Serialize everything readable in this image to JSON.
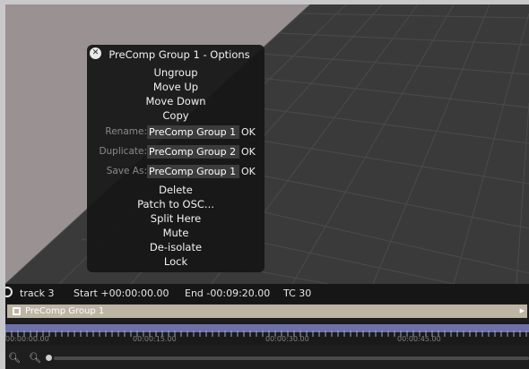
{
  "popup": {
    "title": "PreComp Group 1 - Options",
    "menu_top": [
      "Ungroup",
      "Move Up",
      "Move Down",
      "Copy"
    ],
    "rename": {
      "label": "Rename:",
      "value": "PreComp Group 1",
      "ok": "OK"
    },
    "duplicate": {
      "label": "Duplicate:",
      "value": "PreComp Group 2",
      "ok": "OK"
    },
    "save_as": {
      "label": "Save As:",
      "value": "PreComp Group 1",
      "ok": "OK"
    },
    "menu_bottom": [
      "Delete",
      "Patch to OSC...",
      "Split Here",
      "Mute",
      "De-isolate",
      "Lock"
    ]
  },
  "track": {
    "name": "track 3",
    "start": "Start +00:00:00.00",
    "end": "End -00:09:20.00",
    "tc": "TC 30"
  },
  "group": {
    "label": "PreComp Group 1"
  },
  "ruler": {
    "timecodes": [
      "00:00:00.00",
      "00:00:15.00",
      "00:00:30.00",
      "00:00:45.00"
    ]
  },
  "icons": {
    "close": "close-icon",
    "zoom_out": "zoom-out-icon",
    "zoom_in": "zoom-in-icon",
    "group": "group-icon"
  },
  "colors": {
    "group_bar": "#bdb4a4",
    "ruler_band": "#6d71a8",
    "popup_bg": "#161616"
  }
}
